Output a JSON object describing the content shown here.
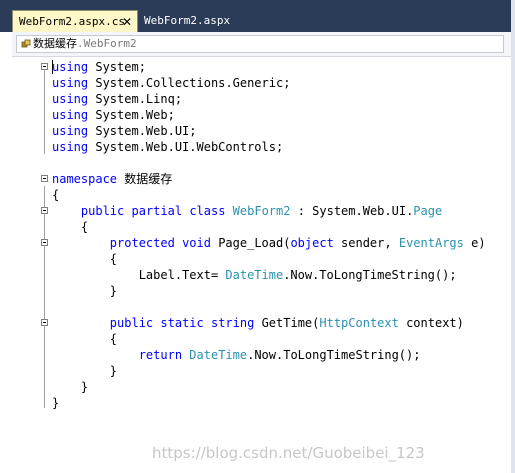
{
  "tabs": [
    {
      "label": "WebForm2.aspx.cs",
      "active": true,
      "close_glyph": "✕"
    },
    {
      "label": "WebForm2.aspx",
      "active": false
    }
  ],
  "nav_bar": {
    "icon": "class-icon",
    "label_main": "数据缓存",
    "label_sub": ".WebForm2"
  },
  "code": {
    "lines": [
      [
        [
          "kw",
          "using"
        ],
        [
          "t",
          " System;"
        ]
      ],
      [
        [
          "kw",
          "using"
        ],
        [
          "t",
          " System.Collections.Generic;"
        ]
      ],
      [
        [
          "kw",
          "using"
        ],
        [
          "t",
          " System.Linq;"
        ]
      ],
      [
        [
          "kw",
          "using"
        ],
        [
          "t",
          " System.Web;"
        ]
      ],
      [
        [
          "kw",
          "using"
        ],
        [
          "t",
          " System.Web.UI;"
        ]
      ],
      [
        [
          "kw",
          "using"
        ],
        [
          "t",
          " System.Web.UI.WebControls;"
        ]
      ],
      [],
      [
        [
          "kw",
          "namespace"
        ],
        [
          "t",
          " 数据缓存"
        ]
      ],
      [
        [
          "t",
          "{"
        ]
      ],
      [
        [
          "t",
          "    "
        ],
        [
          "kw",
          "public"
        ],
        [
          "t",
          " "
        ],
        [
          "kw",
          "partial"
        ],
        [
          "t",
          " "
        ],
        [
          "kw",
          "class"
        ],
        [
          "t",
          " "
        ],
        [
          "ty",
          "WebForm2"
        ],
        [
          "t",
          " : System.Web.UI."
        ],
        [
          "ty",
          "Page"
        ]
      ],
      [
        [
          "t",
          "    {"
        ]
      ],
      [
        [
          "t",
          "        "
        ],
        [
          "kw",
          "protected"
        ],
        [
          "t",
          " "
        ],
        [
          "kw",
          "void"
        ],
        [
          "t",
          " Page_Load("
        ],
        [
          "kw",
          "object"
        ],
        [
          "t",
          " sender, "
        ],
        [
          "ty",
          "EventArgs"
        ],
        [
          "t",
          " e)"
        ]
      ],
      [
        [
          "t",
          "        {"
        ]
      ],
      [
        [
          "t",
          "            Label.Text= "
        ],
        [
          "ty",
          "DateTime"
        ],
        [
          "t",
          ".Now.ToLongTimeString();"
        ]
      ],
      [
        [
          "t",
          "        }"
        ]
      ],
      [],
      [
        [
          "t",
          "        "
        ],
        [
          "kw",
          "public"
        ],
        [
          "t",
          " "
        ],
        [
          "kw",
          "static"
        ],
        [
          "t",
          " "
        ],
        [
          "kw",
          "string"
        ],
        [
          "t",
          " GetTime("
        ],
        [
          "ty",
          "HttpContext"
        ],
        [
          "t",
          " context)"
        ]
      ],
      [
        [
          "t",
          "        {"
        ]
      ],
      [
        [
          "t",
          "            "
        ],
        [
          "kw",
          "return"
        ],
        [
          "t",
          " "
        ],
        [
          "ty",
          "DateTime"
        ],
        [
          "t",
          ".Now.ToLongTimeString();"
        ]
      ],
      [
        [
          "t",
          "        }"
        ]
      ],
      [
        [
          "t",
          "    }"
        ]
      ],
      [
        [
          "t",
          "}"
        ]
      ]
    ]
  },
  "watermark": "https://blog.csdn.net/Guobeibei_123"
}
